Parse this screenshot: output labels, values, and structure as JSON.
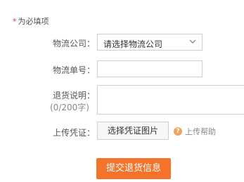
{
  "note": {
    "star": "*",
    "text": "为必填项"
  },
  "form": {
    "carrier": {
      "label": "物流公司：",
      "required_mark": "*",
      "selected": "请选择物流公司",
      "icon": "chevron-down-icon"
    },
    "tracking_no": {
      "label": "物流单号：",
      "required_mark": "*",
      "value": ""
    },
    "return_desc": {
      "label": "退货说明：",
      "counter": "(0/200字)",
      "value": ""
    },
    "upload": {
      "label": "上传凭证：",
      "button": "选择凭证图片",
      "help_icon": "question-icon",
      "help_icon_glyph": "?",
      "help": "上传帮助"
    },
    "submit": "提交退货信息"
  },
  "colors": {
    "required": "#e4393c",
    "submit_bg": "#f4722a",
    "help_icon": "#f0a35c"
  }
}
